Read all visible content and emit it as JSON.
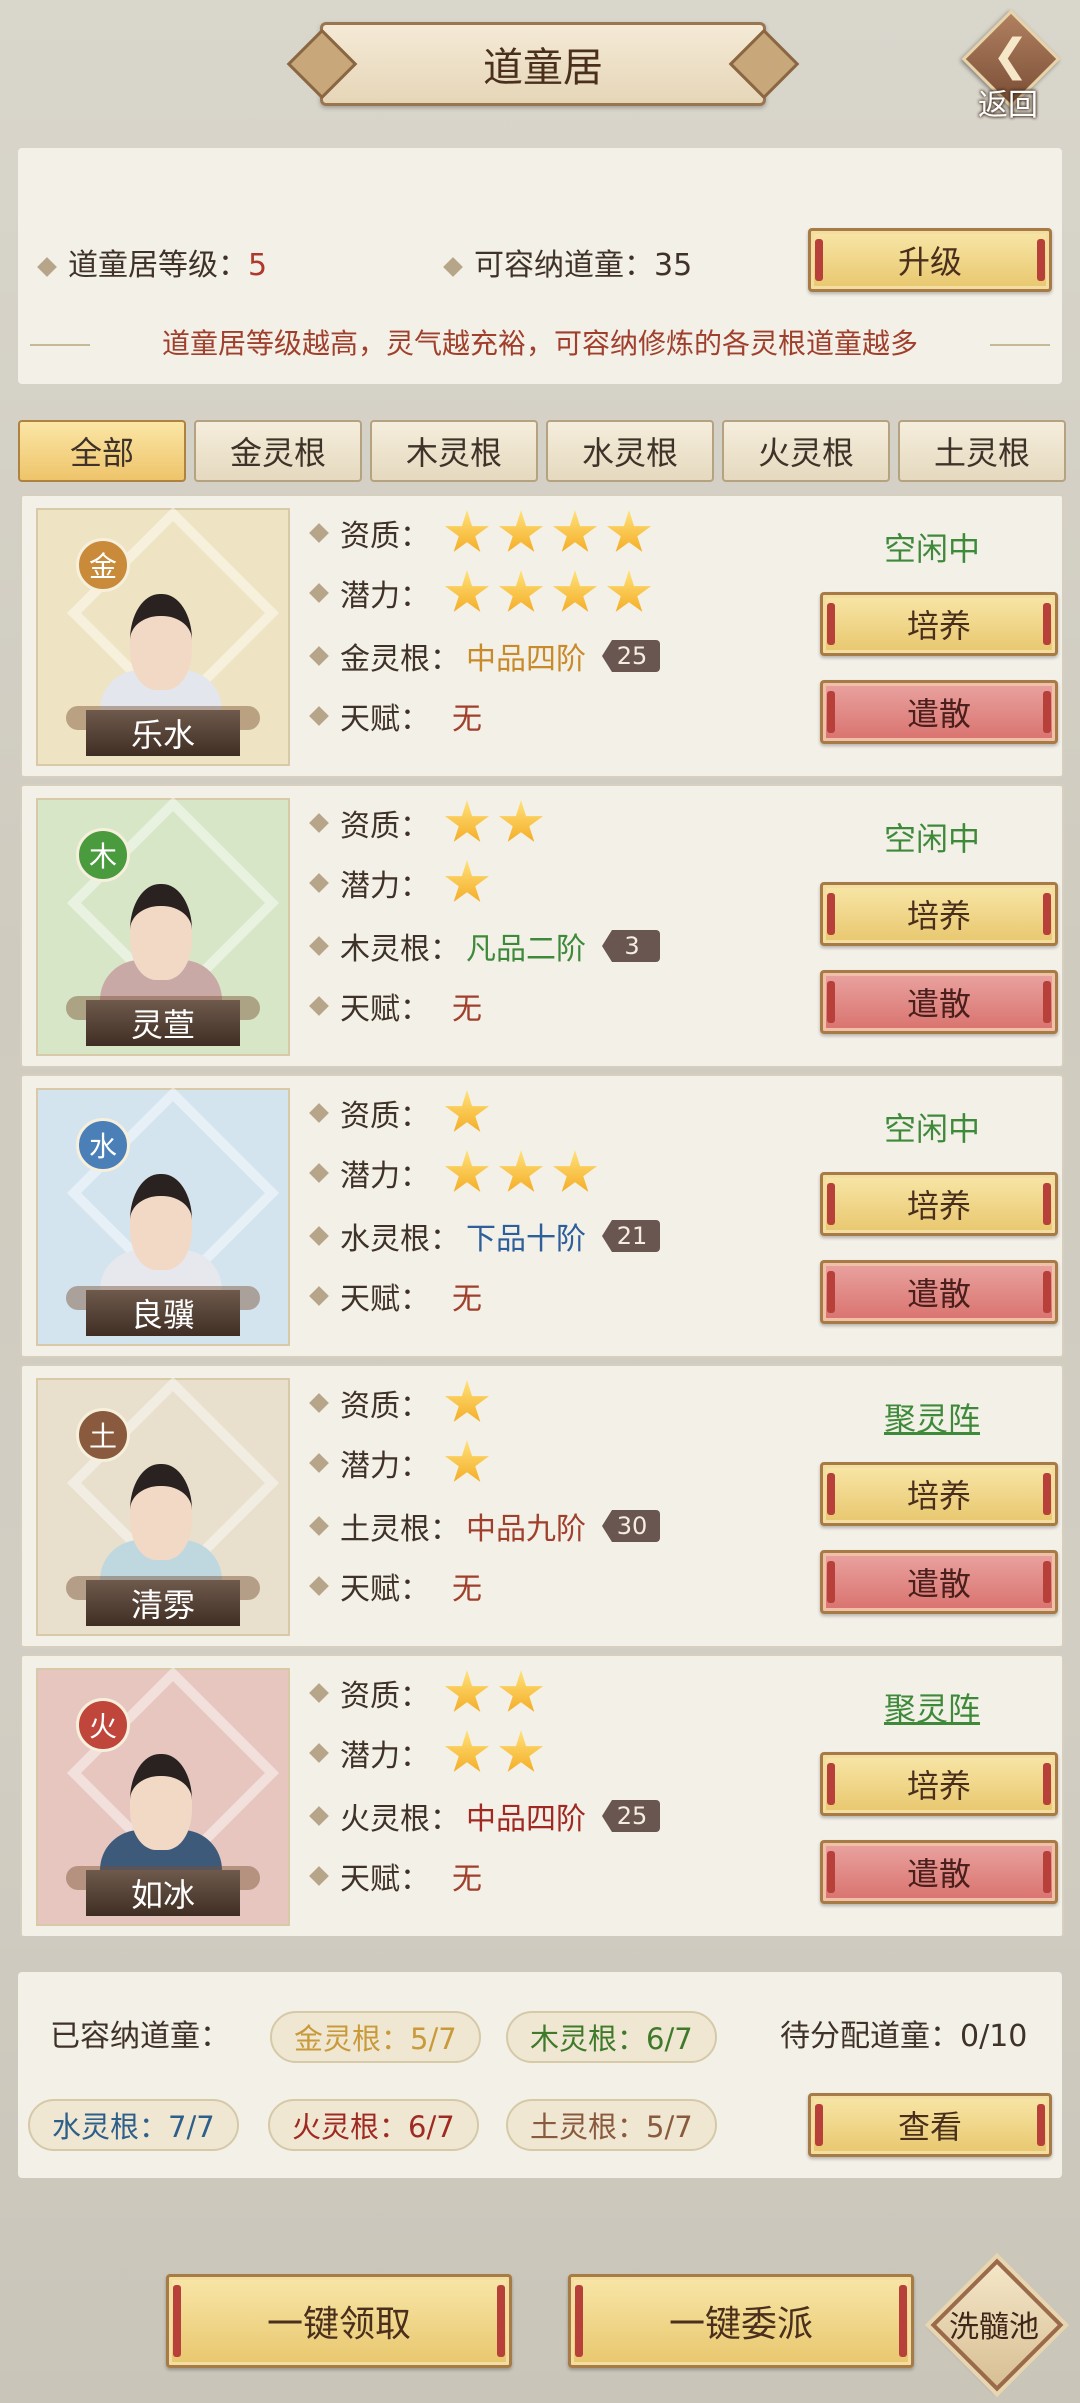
{
  "header": {
    "title": "道童居",
    "back_label": "返回"
  },
  "info": {
    "level_label": "道童居等级：",
    "level_value": "5",
    "capacity_label": "可容纳道童：",
    "capacity_value": "35",
    "upgrade_label": "升级",
    "description": "道童居等级越高，灵气越充裕，可容纳修炼的各灵根道童越多"
  },
  "tabs": [
    {
      "label": "全部",
      "active": true
    },
    {
      "label": "金灵根"
    },
    {
      "label": "木灵根"
    },
    {
      "label": "水灵根"
    },
    {
      "label": "火灵根"
    },
    {
      "label": "土灵根"
    }
  ],
  "labels": {
    "aptitude": "资质：",
    "potential": "潜力：",
    "talent": "天赋：",
    "cultivate": "培养",
    "dismiss": "遣散"
  },
  "disciples": [
    {
      "name": "乐水",
      "element": "金",
      "element_color": "#c98a3a",
      "bg_color": "#eee3c2",
      "aptitude_stars": 4,
      "potential_stars": 4,
      "root_label": "金灵根：",
      "root_grade": "中品四阶",
      "grade_color": "#c98a2a",
      "level": "25",
      "talent": "无",
      "status": "空闲中",
      "status_link": false,
      "robe": "#e3e6ec"
    },
    {
      "name": "灵萱",
      "element": "木",
      "element_color": "#4a9a3e",
      "bg_color": "#d7e6c6",
      "aptitude_stars": 2,
      "potential_stars": 1,
      "root_label": "木灵根：",
      "root_grade": "凡品二阶",
      "grade_color": "#3f8a3a",
      "level": "3",
      "talent": "无",
      "status": "空闲中",
      "status_link": false,
      "robe": "#c9a9a6"
    },
    {
      "name": "良骥",
      "element": "水",
      "element_color": "#4a7fb8",
      "bg_color": "#d3e4ee",
      "aptitude_stars": 1,
      "potential_stars": 3,
      "root_label": "水灵根：",
      "root_grade": "下品十阶",
      "grade_color": "#2e5f9a",
      "level": "21",
      "talent": "无",
      "status": "空闲中",
      "status_link": false,
      "robe": "#e6e8ee"
    },
    {
      "name": "清雰",
      "element": "土",
      "element_color": "#8a5a3e",
      "bg_color": "#e8dfcc",
      "aptitude_stars": 1,
      "potential_stars": 1,
      "root_label": "土灵根：",
      "root_grade": "中品九阶",
      "grade_color": "#a0402c",
      "level": "30",
      "talent": "无",
      "status": "聚灵阵",
      "status_link": true,
      "robe": "#bfd8df"
    },
    {
      "name": "如冰",
      "element": "火",
      "element_color": "#c0453a",
      "bg_color": "#e7c6c0",
      "aptitude_stars": 2,
      "potential_stars": 2,
      "root_label": "火灵根：",
      "root_grade": "中品四阶",
      "grade_color": "#a02a22",
      "level": "25",
      "talent": "无",
      "status": "聚灵阵",
      "status_link": true,
      "robe": "#3e5a7a"
    }
  ],
  "summary": {
    "label": "已容纳道童：",
    "pending_label": "待分配道童：0/10",
    "view_label": "查看",
    "roots": [
      {
        "text": "金灵根：5/7",
        "color": "#c99a3a"
      },
      {
        "text": "木灵根：6/7",
        "color": "#3f7a2a"
      },
      {
        "text": "水灵根：7/7",
        "color": "#2e5f8a"
      },
      {
        "text": "火灵根：6/7",
        "color": "#a02a22"
      },
      {
        "text": "土灵根：5/7",
        "color": "#8a5a3e"
      }
    ]
  },
  "bottom": {
    "claim_label": "一键领取",
    "dispatch_label": "一键委派",
    "marrow_label": "洗髓池"
  }
}
